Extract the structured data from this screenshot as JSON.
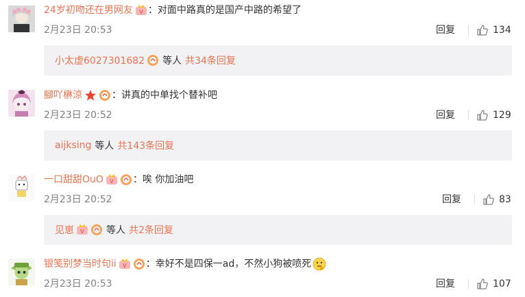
{
  "comments": [
    {
      "username": "24岁初吻还在男网友",
      "colon": "：",
      "text": "对面中路真的是国产中路的希望了",
      "time": "2月23日 20:53",
      "reply_label": "回复",
      "likes": "134",
      "reply_box": {
        "users": "小太虚6027301682",
        "mid": "等人",
        "total": "共34条回复"
      }
    },
    {
      "username": "腳吖楙涼",
      "colon": "：",
      "text": "讲真的中单找个替补吧",
      "time": "2月23日 20:52",
      "reply_label": "回复",
      "likes": "129",
      "reply_box": {
        "users": "aijksing",
        "mid": "等人",
        "total": "共143条回复"
      }
    },
    {
      "username": "一口甜甜OuO",
      "colon": "：",
      "text": "唉 你加油吧",
      "time": "2月23日 20:52",
      "reply_label": "回复",
      "likes": "83",
      "reply_box": {
        "users": "见崽",
        "mid": "等人",
        "total": "共2条回复"
      }
    },
    {
      "username": "银笺别梦当时句ii",
      "colon": "：",
      "text": "幸好不是四保一ad，不然小狗被喷死",
      "time": "2月23日 20:53",
      "reply_label": "回复",
      "likes": "107"
    }
  ],
  "colors": {
    "username": "#eb7350",
    "reply_bg": "#f2f2f5",
    "time": "#808080"
  }
}
